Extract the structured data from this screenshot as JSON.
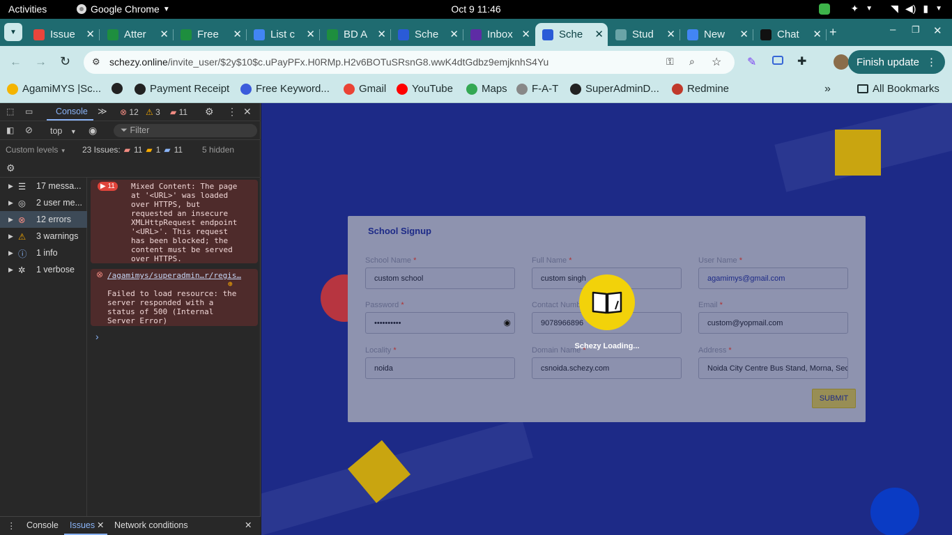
{
  "gnome": {
    "activities": "Activities",
    "app": "Google Chrome",
    "clock": "Oct 9  11:46"
  },
  "tabs": [
    {
      "label": "Issue",
      "fav": "#e8453c",
      "icon": "redmine-icon"
    },
    {
      "label": "Atter",
      "fav": "#1e8e3e",
      "icon": "sheets-icon"
    },
    {
      "label": "Free",
      "fav": "#1e8e3e",
      "icon": "forms-icon"
    },
    {
      "label": "List c",
      "fav": "#4285f4",
      "icon": "docs-icon"
    },
    {
      "label": "BD A",
      "fav": "#1e8e3e",
      "icon": "sheets-icon"
    },
    {
      "label": "Sche",
      "fav": "#2a5bd7",
      "icon": "schezy-icon"
    },
    {
      "label": "Inbox",
      "fav": "#5e2ca5",
      "icon": "yopmail-icon"
    },
    {
      "label": "Sche",
      "fav": "#2a5bd7",
      "icon": "schezy-icon"
    },
    {
      "label": "Stud",
      "fav": "#6aa4a7",
      "icon": "loading-icon"
    },
    {
      "label": "New",
      "fav": "#4285f4",
      "icon": "docs-icon"
    },
    {
      "label": "Chat",
      "fav": "#111111",
      "icon": "chatgpt-icon"
    }
  ],
  "address": {
    "host": "schezy.online",
    "path": "/invite_user/$2y$10$c.uPayPFx.H0RMp.H2v6BOTuSRsnG8.wwK4dtGdbz9emjknhS4Yu"
  },
  "finish_update": "Finish update",
  "bookmarks": [
    {
      "label": "AgamiMYS |Sc...",
      "color": "#f4b400"
    },
    {
      "label": "",
      "color": "#222222"
    },
    {
      "label": "Payment Receipt",
      "color": "#222222"
    },
    {
      "label": "Free Keyword...",
      "color": "#3b5bdb"
    },
    {
      "label": "Gmail",
      "color": "#ea4335"
    },
    {
      "label": "YouTube",
      "color": "#ff0000"
    },
    {
      "label": "Maps",
      "color": "#34a853"
    },
    {
      "label": "F-A-T",
      "color": "#888888"
    },
    {
      "label": "SuperAdminD...",
      "color": "#222222"
    },
    {
      "label": "Redmine",
      "color": "#c0392b"
    }
  ],
  "all_bookmarks": "All Bookmarks",
  "devtools": {
    "console_tab": "Console",
    "err_count": "12",
    "warn_count": "3",
    "issue_count": "11",
    "context": "top",
    "filter_placeholder": "Filter",
    "custom_levels": "Custom levels",
    "issues_label": "23 Issues:",
    "iss_err": "11",
    "iss_warn": "1",
    "iss_info": "11",
    "hidden": "5 hidden",
    "sidebar": [
      {
        "label": "17 messa...",
        "icon": "list-icon"
      },
      {
        "label": "2 user me...",
        "icon": "user-icon"
      },
      {
        "label": "12 errors",
        "icon": "error-icon"
      },
      {
        "label": "3 warnings",
        "icon": "warning-icon"
      },
      {
        "label": "1 info",
        "icon": "info-icon"
      },
      {
        "label": "1 verbose",
        "icon": "bug-icon"
      }
    ],
    "msg1_badge": "11",
    "msg1_text": "Mixed Content: The page\nat '<URL>' was loaded\nover HTTPS, but\nrequested an insecure\nXMLHttpRequest endpoint\n'<URL>'. This request\nhas been blocked; the\ncontent must be served\nover HTTPS.",
    "msg2_link": "/agamimys/superadmin…r/regis…",
    "msg2_text": "Failed to load resource: the\nserver responded with a\nstatus of 500 (Internal\nServer Error)",
    "prompt": "›",
    "bottom_tabs": [
      "Console",
      "Issues",
      "Network conditions"
    ]
  },
  "form": {
    "title": "School Signup",
    "fields": [
      {
        "label": "School Name",
        "value": "custom school"
      },
      {
        "label": "Full Name",
        "value": "custom singh"
      },
      {
        "label": "User Name",
        "value": "agamimys@gmail.com"
      },
      {
        "label": "Password",
        "value": "••••••••••"
      },
      {
        "label": "Contact Number",
        "value": "9078966896"
      },
      {
        "label": "Email",
        "value": "custom@yopmail.com"
      },
      {
        "label": "Locality",
        "value": "noida"
      },
      {
        "label": "Domain Name",
        "value": "csnoida.schezy.com"
      },
      {
        "label": "Address",
        "value": "Noida City Centre Bus Stand, Morna, Sector"
      }
    ],
    "required_mark": "*",
    "submit": "SUBMIT"
  },
  "loading": "Schezy Loading..."
}
